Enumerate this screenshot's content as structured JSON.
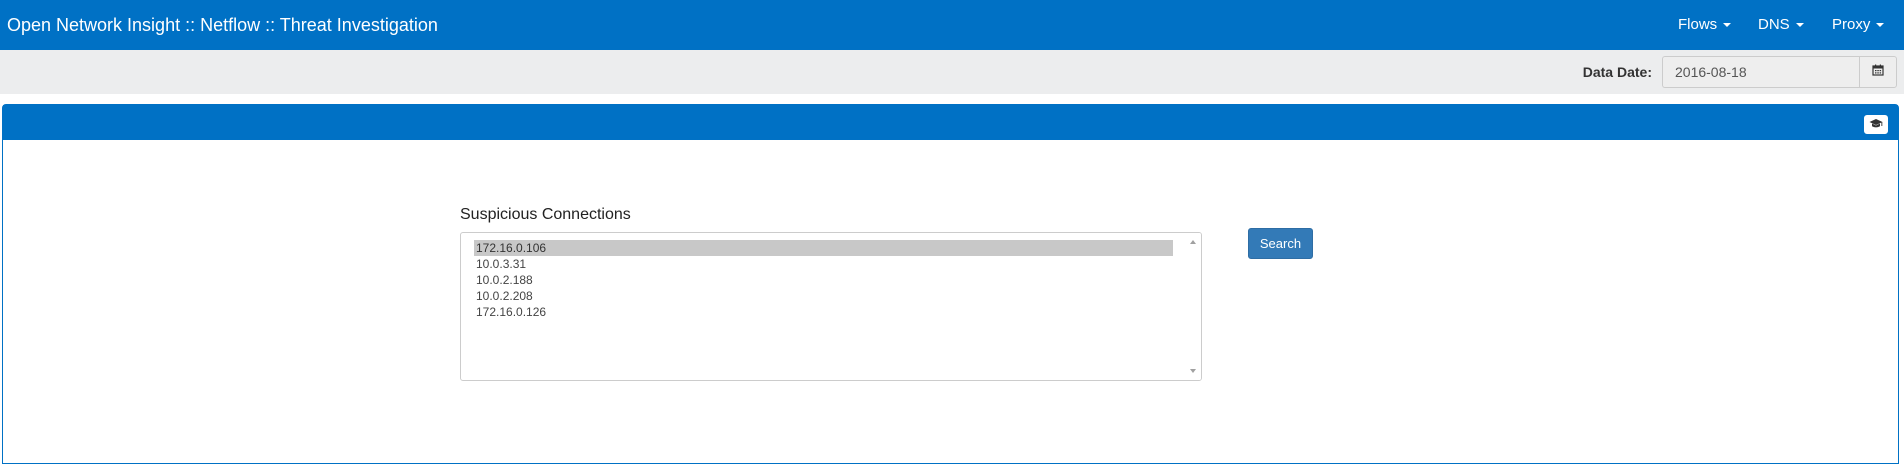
{
  "header": {
    "title": "Open Network Insight :: Netflow :: Threat Investigation",
    "menus": [
      {
        "label": "Flows"
      },
      {
        "label": "DNS"
      },
      {
        "label": "Proxy"
      }
    ]
  },
  "toolbar": {
    "date_label": "Data Date:",
    "date_value": "2016-08-18",
    "calendar_icon": "calendar-icon"
  },
  "panel": {
    "heading_icon": "graduation-cap-icon",
    "list_label": "Suspicious Connections",
    "items": [
      "172.16.0.106",
      "10.0.3.31",
      "10.0.2.188",
      "10.0.2.208",
      "172.16.0.126"
    ],
    "selected_item": "172.16.0.106",
    "search_label": "Search"
  },
  "colors": {
    "brand_blue": "#0071c5",
    "button_blue": "#337ab7",
    "subbar_gray": "#ecedee",
    "selection_gray": "#c8c8c8"
  }
}
